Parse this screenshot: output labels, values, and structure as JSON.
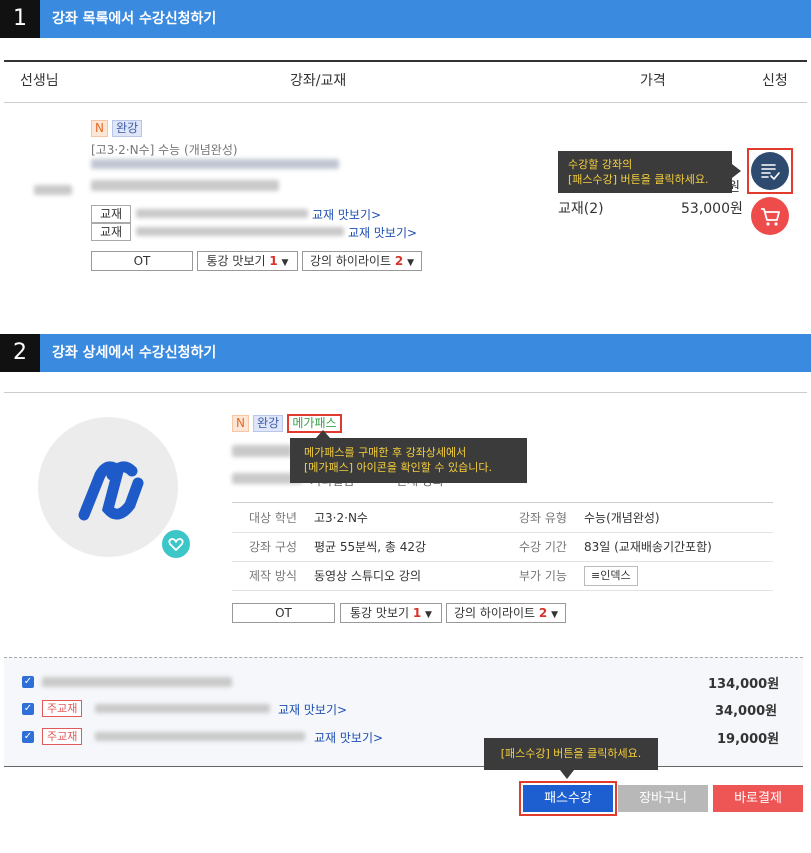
{
  "section1": {
    "number": "1",
    "title": "강좌 목록에서 수강신청하기"
  },
  "table_header": {
    "teacher": "선생님",
    "course": "강좌/교재",
    "price": "가격",
    "apply": "신청"
  },
  "course1": {
    "tag_n": "N",
    "tag_complete": "완강",
    "category": "[고3·2·N수] 수능 (개념완성)",
    "book_tag": "교재",
    "book_link1": "교재 맛보기>",
    "book_link2": "교재 맛보기>",
    "ot": "OT",
    "sample_label": "통강 맛보기",
    "sample_count": "1",
    "highlight_label": "강의 하이라이트",
    "highlight_count": "2",
    "dropdown_arrow": "▼",
    "price_row1_prefix": "강",
    "price_row1_value": "원",
    "price_row2_label": "교재(2)",
    "price_row2_value": "53,000원",
    "tooltip_line1": "수강할 강좌의",
    "tooltip_line2": "[패스수강] 버튼을 클릭하세요."
  },
  "section2": {
    "number": "2",
    "title": "강좌 상세에서 수강신청하기"
  },
  "detail": {
    "tag_n": "N",
    "tag_complete": "완강",
    "tag_megapass": "메가패스",
    "tooltip_line1": "메가패스를 구매한 후 강좌상세에서",
    "tooltip_line2": "[메가패스] 아이콘을 확인할 수 있습니다.",
    "partial_text1": "거리걸심",
    "partial_text2": "신재 강화",
    "info": [
      {
        "l1": "대상 학년",
        "v1": "고3·2·N수",
        "l2": "강좌 유형",
        "v2": "수능(개념완성)"
      },
      {
        "l1": "강좌 구성",
        "v1": "평균 55분씩, 총 42강",
        "l2": "수강 기간",
        "v2": "83일 (교재배송기간포함)"
      },
      {
        "l1": "제작 방식",
        "v1": "동영상 스튜디오 강의",
        "l2": "부가 기능",
        "v2": "인덱스"
      }
    ],
    "index_icon": "≡",
    "ot": "OT",
    "sample_label": "통강 맛보기",
    "sample_count": "1",
    "highlight_label": "강의 하이라이트",
    "highlight_count": "2",
    "dropdown_arrow": "▼"
  },
  "cart": {
    "rows": [
      {
        "tag": "",
        "link": "",
        "price": "134,000원"
      },
      {
        "tag": "주교재",
        "link": "교재 맛보기>",
        "price": "34,000원"
      },
      {
        "tag": "주교재",
        "link": "교재 맛보기>",
        "price": "19,000원"
      }
    ],
    "check_mark": "✓",
    "tooltip": "[패스수강] 버튼을 클릭하세요.",
    "pass_button": "패스수강",
    "cart_button": "장바구니",
    "buy_button": "바로결제"
  },
  "colors": {
    "blue": "#3a8be0",
    "navy_circle": "#2e4a6e",
    "red_circle": "#ee4b4b",
    "highlight": "#e23b2e"
  }
}
